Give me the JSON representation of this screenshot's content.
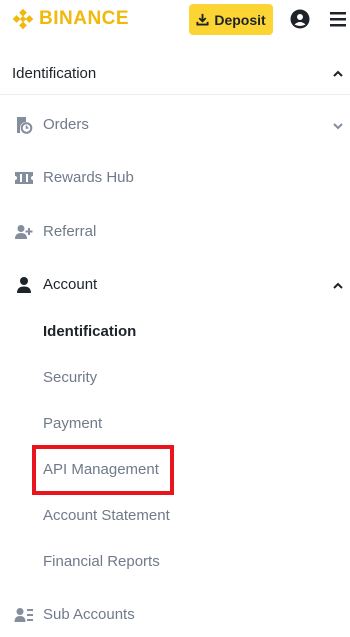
{
  "header": {
    "brand": "BINANCE",
    "deposit_label": "Deposit",
    "brand_color": "#f0b90b",
    "accent_color": "#fcd535"
  },
  "section": {
    "title": "Identification"
  },
  "nav": {
    "orders": "Orders",
    "rewards_hub": "Rewards Hub",
    "referral": "Referral",
    "account": "Account",
    "sub_accounts": "Sub Accounts"
  },
  "account_menu": {
    "items": [
      "Identification",
      "Security",
      "Payment",
      "API Management",
      "Account Statement",
      "Financial Reports"
    ]
  },
  "highlight_color": "#e8141e"
}
